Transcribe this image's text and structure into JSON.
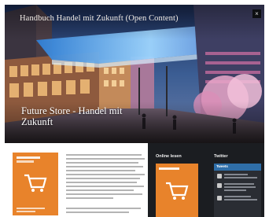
{
  "site": {
    "title": "Handbuch Handel mit Zukunft (Open Content)"
  },
  "window": {
    "close_label": "×"
  },
  "article": {
    "headline": "Future Store - Handel mit Zukunft"
  },
  "sidebar": {
    "online_heading": "Online lesen",
    "twitter_heading": "Twitter",
    "widget_title": "Tweets"
  },
  "colors": {
    "accent_orange": "#e8832b",
    "dark_background": "#1b1d21",
    "twitter_blue": "#2f6ea8"
  },
  "icons": {
    "cart": "shopping-cart-icon",
    "close": "close-icon"
  }
}
